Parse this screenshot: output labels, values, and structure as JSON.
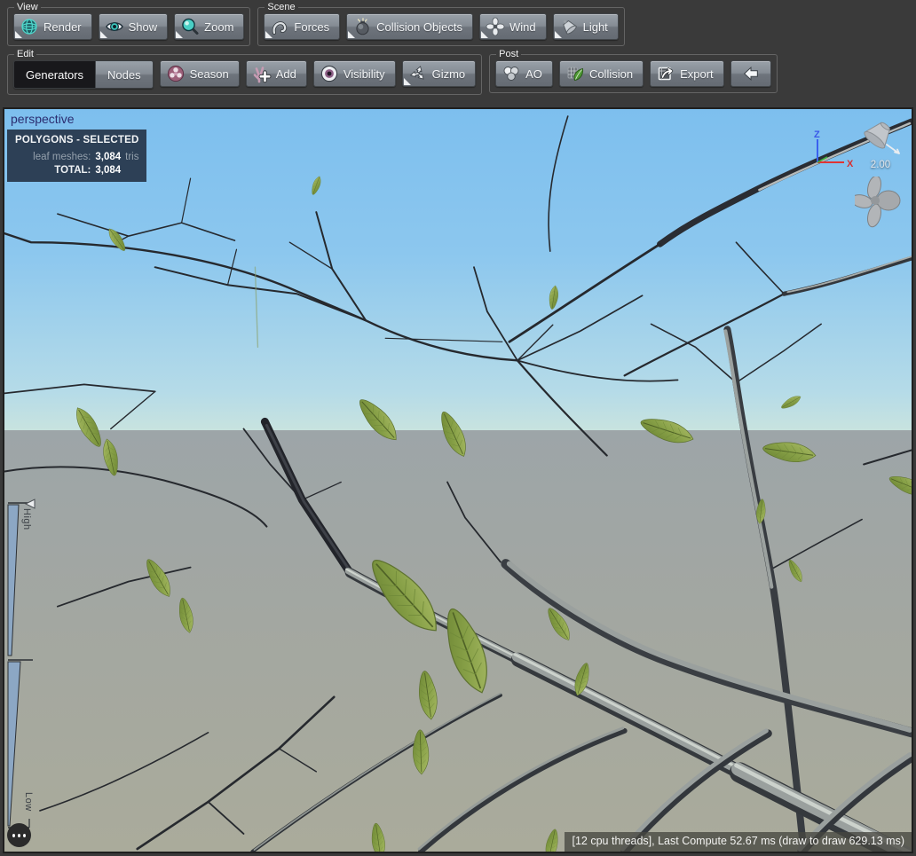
{
  "colors": {
    "window_bg": "#3a3a3a",
    "accent_teal": "#49d0c6",
    "sky_top": "#7dbfee",
    "sky_horizon": "#c8e3df",
    "ground_top": "#9da5a8",
    "ground_bottom": "#aaab9b",
    "leaf_green": "#87a047",
    "panel_bg": "#27364a",
    "selected_tab_bg": "#18181b"
  },
  "toolbar": {
    "view": {
      "label": "View",
      "buttons": [
        {
          "label": "Render"
        },
        {
          "label": "Show"
        },
        {
          "label": "Zoom"
        }
      ]
    },
    "scene": {
      "label": "Scene",
      "buttons": [
        {
          "label": "Forces"
        },
        {
          "label": "Collision Objects"
        },
        {
          "label": "Wind"
        },
        {
          "label": "Light"
        }
      ]
    },
    "edit": {
      "label": "Edit",
      "segmented": [
        {
          "label": "Generators",
          "selected": true
        },
        {
          "label": "Nodes",
          "selected": false
        }
      ],
      "buttons": [
        {
          "label": "Season"
        },
        {
          "label": "Add"
        },
        {
          "label": "Visibility"
        },
        {
          "label": "Gizmo"
        }
      ]
    },
    "post": {
      "label": "Post",
      "buttons": [
        {
          "label": "AO"
        },
        {
          "label": "Collision"
        },
        {
          "label": "Export"
        }
      ]
    }
  },
  "viewport": {
    "camera_label": "perspective",
    "polygons_panel": {
      "title": "POLYGONS - SELECTED",
      "rows": [
        {
          "label": "leaf meshes:",
          "value": "3,084",
          "suffix": "tris"
        },
        {
          "label": "TOTAL:",
          "value": "3,084",
          "suffix": ""
        }
      ]
    },
    "axis_gizmo": {
      "z_label": "Z",
      "x_label": "X"
    },
    "light_widget": {
      "value": "2.00"
    },
    "lod_slider": {
      "high_label": "High",
      "low_label": "Low"
    },
    "status_bar": "[12 cpu threads], Last Compute 52.67 ms (draw to draw 629.13 ms)"
  },
  "icons": {
    "render": "wireframe-sphere",
    "show": "eye",
    "zoom": "magnifier",
    "forces": "magnet-curve",
    "collision_objects": "bomb",
    "wind": "fan",
    "light": "spotlight",
    "season": "flower",
    "add": "branch-plus",
    "visibility": "eyeball",
    "gizmo": "move-arrows",
    "ao": "sphere-cluster",
    "collision": "mesh-leaf",
    "export": "box-arrow",
    "back": "left-arrow",
    "menu": "ellipsis-dots",
    "dropdown": "corner-triangle"
  }
}
